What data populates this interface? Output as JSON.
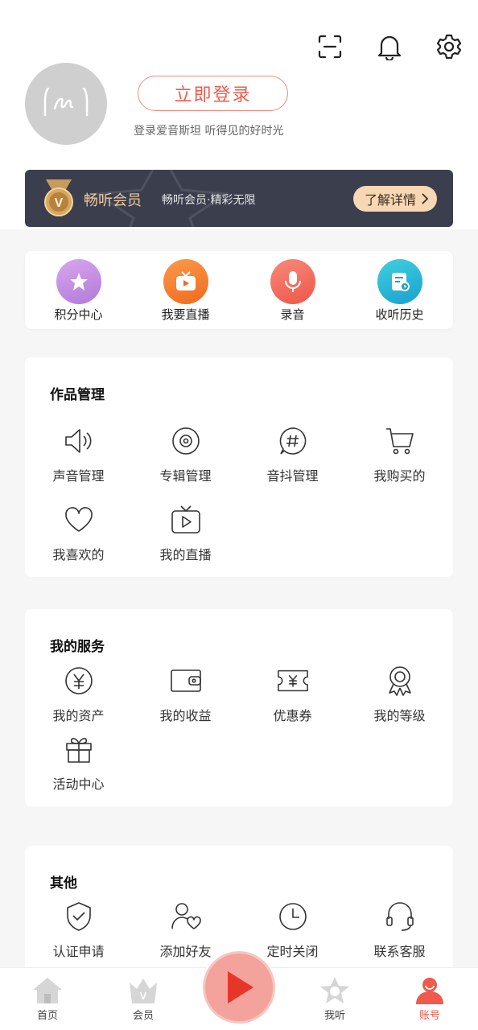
{
  "header": {
    "icons": [
      "scan-icon",
      "bell-icon",
      "gear-icon"
    ],
    "login_label": "立即登录",
    "login_sub": "登录爱音斯坦 听得见的好时光"
  },
  "vip": {
    "title": "畅听会员",
    "desc": "畅听会员·精彩无限",
    "button_label": "了解详情"
  },
  "quick": [
    {
      "label": "积分中心",
      "icon": "star-icon",
      "color": "#c58be0"
    },
    {
      "label": "我要直播",
      "icon": "live-tv-icon",
      "color": "#f57a2c"
    },
    {
      "label": "录音",
      "icon": "mic-icon",
      "color": "#f2695c"
    },
    {
      "label": "收听历史",
      "icon": "history-icon",
      "color": "#2bb5d6"
    }
  ],
  "works": {
    "title": "作品管理",
    "items": [
      {
        "label": "声音管理",
        "icon": "speaker-icon"
      },
      {
        "label": "专辑管理",
        "icon": "album-disc-icon"
      },
      {
        "label": "音抖管理",
        "icon": "hashtag-icon"
      },
      {
        "label": "我购买的",
        "icon": "cart-icon"
      },
      {
        "label": "我喜欢的",
        "icon": "heart-icon"
      },
      {
        "label": "我的直播",
        "icon": "tv-play-icon"
      }
    ]
  },
  "services": {
    "title": "我的服务",
    "items": [
      {
        "label": "我的资产",
        "icon": "yuan-coin-icon"
      },
      {
        "label": "我的收益",
        "icon": "wallet-icon"
      },
      {
        "label": "优惠券",
        "icon": "coupon-icon"
      },
      {
        "label": "我的等级",
        "icon": "medal-icon"
      },
      {
        "label": "活动中心",
        "icon": "gift-icon"
      }
    ]
  },
  "other": {
    "title": "其他",
    "items": [
      {
        "label": "认证申请",
        "icon": "shield-check-icon"
      },
      {
        "label": "添加好友",
        "icon": "add-friend-icon"
      },
      {
        "label": "定时关闭",
        "icon": "clock-icon"
      },
      {
        "label": "联系客服",
        "icon": "headset-icon"
      }
    ]
  },
  "tabbar": {
    "items": [
      {
        "label": "首页",
        "icon": "home-icon"
      },
      {
        "label": "会员",
        "icon": "crown-icon"
      },
      {
        "label": "我听",
        "icon": "star-tab-icon"
      },
      {
        "label": "账号",
        "icon": "account-icon",
        "active": true
      }
    ],
    "accent": "#ef5a4c"
  }
}
